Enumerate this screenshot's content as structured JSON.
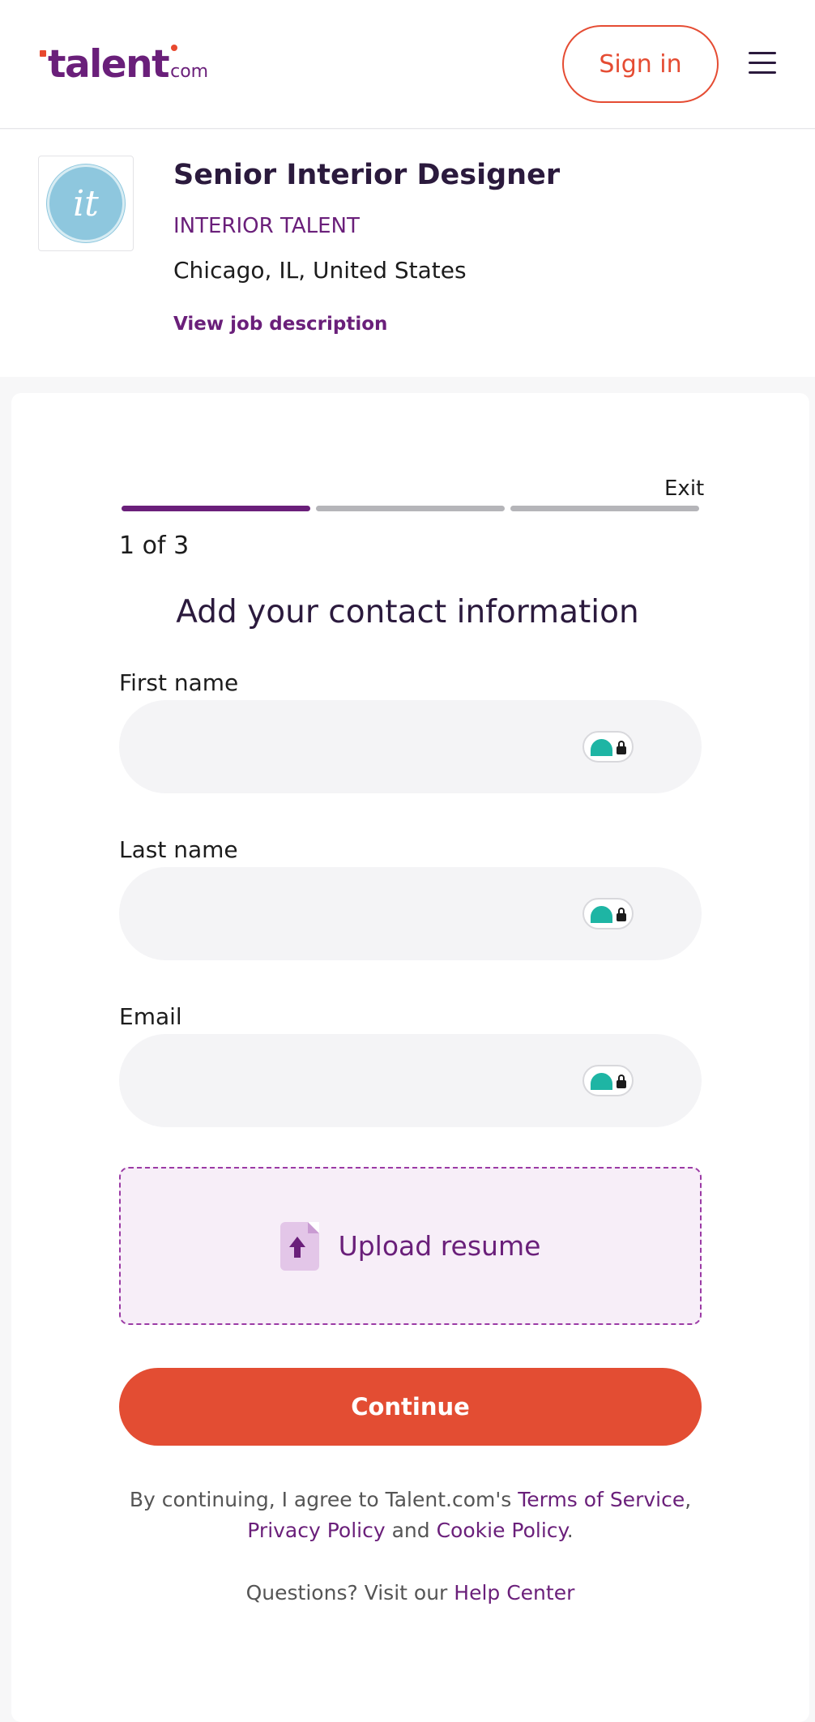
{
  "header": {
    "logo_main": "talent",
    "logo_suffix": "com",
    "signin_label": "Sign in"
  },
  "job": {
    "title": "Senior Interior Designer",
    "company": "INTERIOR TALENT",
    "location": "Chicago, IL, United States",
    "view_description": "View job description",
    "company_logo_text": "it"
  },
  "progress": {
    "exit_label": "Exit",
    "step_text": "1 of 3",
    "current": 1,
    "total": 3
  },
  "form": {
    "title": "Add your contact information",
    "fields": [
      {
        "label": "First name",
        "value": ""
      },
      {
        "label": "Last name",
        "value": ""
      },
      {
        "label": "Email",
        "value": ""
      }
    ],
    "upload_label": "Upload resume",
    "continue_label": "Continue"
  },
  "legal": {
    "prefix": "By continuing, I agree to Talent.com's ",
    "terms": "Terms of Service",
    "comma": ",",
    "privacy": "Privacy Policy",
    "and": " and ",
    "cookie": "Cookie Policy",
    "period": "."
  },
  "help": {
    "prefix": "Questions? Visit our ",
    "link": "Help Center"
  },
  "colors": {
    "brand_purple": "#6a1f7a",
    "accent_orange": "#e34d33",
    "heading_dark": "#2b1a3d",
    "field_bg": "#f4f4f6",
    "badge_teal": "#1eb5a4"
  },
  "icons": {
    "menu": "hamburger-menu-icon",
    "upload": "file-upload-icon",
    "password_manager": "password-manager-icon"
  }
}
